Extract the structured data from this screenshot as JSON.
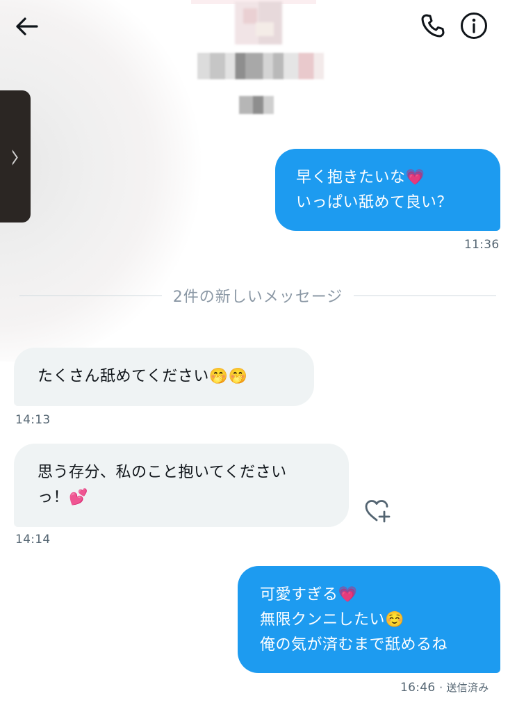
{
  "header": {
    "back_icon": "arrow-left-icon",
    "call_icon": "phone-icon",
    "info_icon": "info-icon"
  },
  "messages": [
    {
      "direction": "sent",
      "lines": [
        "早く抱きたいな💗",
        "いっぱい舐めて良い？"
      ],
      "time": "11:36"
    },
    {
      "direction": "received",
      "lines": [
        "たくさん舐めてください🤭🤭"
      ],
      "time": "14:13"
    },
    {
      "direction": "received",
      "lines": [
        "思う存分、私のこと抱いてください",
        "っ！💕"
      ],
      "time": "14:14"
    },
    {
      "direction": "sent",
      "lines": [
        "可愛すぎる💗",
        "無限クンニしたい☺️",
        "俺の気が済むまで舐めるね"
      ],
      "time": "16:46",
      "status": "· 送信済み"
    }
  ],
  "divider": {
    "label": "2件の新しいメッセージ"
  },
  "reaction": {
    "icon": "heart-plus-icon"
  },
  "colors": {
    "sent_bubble": "#1d9bf0",
    "received_bubble": "#eff3f4",
    "timestamp": "#536471",
    "divider_text": "#8b98a5"
  }
}
